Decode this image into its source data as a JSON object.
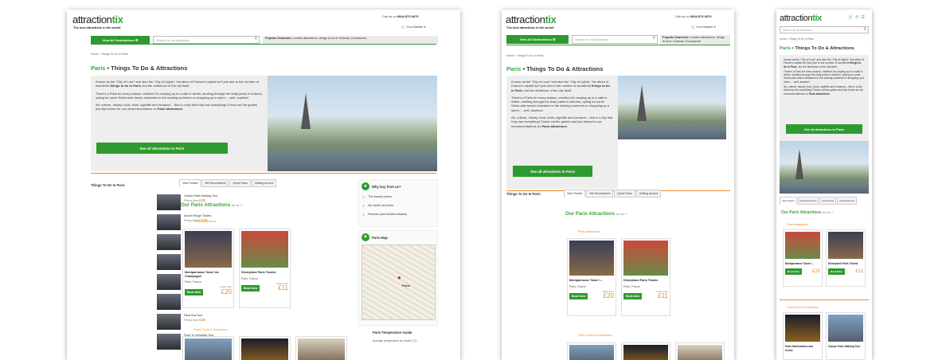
{
  "brand": {
    "logo_main": "attraction",
    "logo_accent": "tix",
    "tagline": "The best attractions in the world!"
  },
  "header": {
    "call_text": "Call us on",
    "phone": "0844 873 0070",
    "basket": "Your Basket"
  },
  "nav": {
    "all_destinations": "View All Destinations",
    "search_placeholder": "Search for an Attraction",
    "popular_label": "Popular Searches:",
    "popular_links": "London attractions, things to do in Orlando, Eurostones"
  },
  "breadcrumb": "Home > Things To Do In Paris",
  "page": {
    "title_city": "Paris",
    "title_rest": "Things To Do & Attractions"
  },
  "intro": {
    "p1": "Known as the \"City of Love\" and also the \"City of Lights\", the allure of France's capital isn't just due to the number of wonderful things to do in Paris, but the ambience of the city itself.",
    "p2": "There's a Paris for every season, whether it's cosying up in a cafe in winter, strolling through the leafy parks in Autumn, opting for some Seine-side beach relaxation in the sizzling summers or shopping up a storm.... well, anytime!",
    "p3": "Art, culture, history, food, drink, nightlife and romance – this is a city that truly has everything! Check out the guides and tips below for our recommendations on Paris attractions.",
    "cta": "See all attractions in Paris"
  },
  "sidebar": {
    "title": "Things To Do In Paris",
    "items": [
      {
        "name": "Classic Paris Walking Tour",
        "price": "£18"
      },
      {
        "name": "Moulin Rouge Tickets",
        "price": "£176"
      },
      {
        "name": "Montparnasse Tower Inc Champagne",
        "price": "£20"
      },
      {
        "name": "Paris Illuminations and Cruise",
        "price": "£21"
      },
      {
        "name": "Paris Illuminations and Cruise",
        "price": "£21"
      },
      {
        "name": "Paris Boats",
        "price": "£84"
      },
      {
        "name": "Paris Bus Tour",
        "price": "£15"
      },
      {
        "name": "Paris To Versailles Tour",
        "price": "£68"
      }
    ],
    "mobile_items": [
      {
        "name": "Classic Paris Walking Tour",
        "price": "£18"
      },
      {
        "name": "Moulin Rouge Tickets",
        "price": "£176"
      },
      {
        "name": "Montparnasse Tower Inc Champagne",
        "price": "£20"
      },
      {
        "name": "Paris Illuminations and Cruise",
        "price": "£21"
      }
    ],
    "prices_from": "Prices from"
  },
  "tabs": [
    "View Tickets",
    "We Recommend",
    "Quick Facts",
    "Getting Around"
  ],
  "attractions": {
    "heading": "Our Paris Attractions",
    "see_all": "see all >>",
    "sub1": "Paris attractions",
    "sub2": "Paris Tours & Excursions",
    "cards": [
      {
        "title": "Montparnasse Tower Inc Champagne",
        "title_short": "Montparnasse Tower I...",
        "location": "Paris, France",
        "price": "£20",
        "prices_from": "prices from"
      },
      {
        "title": "Disneyland Paris Tickets",
        "title_short": "Disneyland Paris Tickets",
        "location": "Paris, France",
        "price": "£11",
        "prices_from": "prices from"
      }
    ],
    "book": "Book Now",
    "mobile_tours": [
      "Paris Illuminations and Cruise",
      "Classic Paris Walking Tour"
    ]
  },
  "why": {
    "title": "Why buy from us?",
    "items": [
      "The lowest prices",
      "No credit card fees",
      "Receive your tickets instantly"
    ]
  },
  "map": {
    "title": "Paris Map",
    "city": "Paris"
  },
  "temp": {
    "title": "Paris Temperature Guide",
    "sub": "Average temperature by month (°C)"
  },
  "colors": {
    "brand_green": "#2f9a2f",
    "accent_orange": "#f08a24"
  }
}
